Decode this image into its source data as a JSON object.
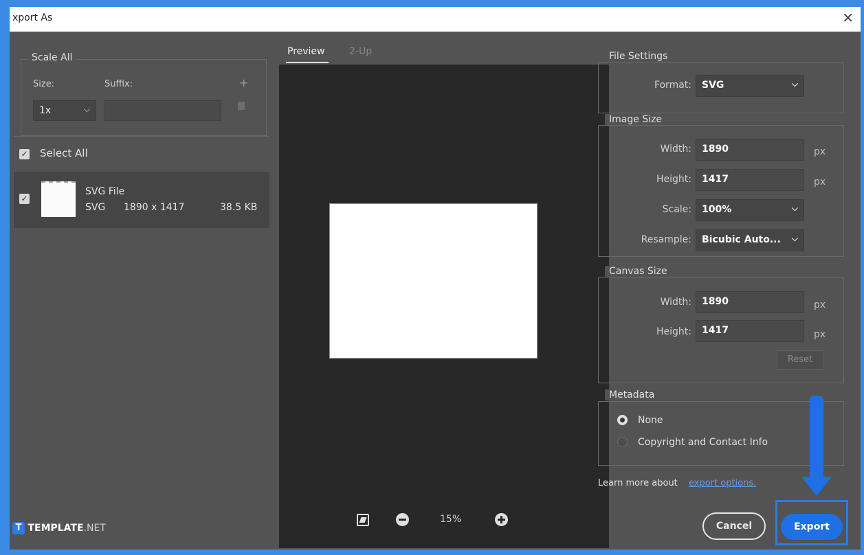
{
  "window": {
    "title": "xport As",
    "close_glyph": "✕"
  },
  "scale_all": {
    "title": "Scale All",
    "size_label": "Size:",
    "suffix_label": "Suffix:",
    "size_value": "1x",
    "suffix_value": "",
    "add_icon": "plus-icon",
    "delete_icon": "trash-icon"
  },
  "select_all": {
    "label": "Select All",
    "checked": true
  },
  "file_item": {
    "name": "SVG File",
    "format": "SVG",
    "dimensions": "1890 x 1417",
    "size": "38.5 KB",
    "checked": true
  },
  "watermark": {
    "brand_bold": "TEMPLATE",
    "brand_light": ".NET",
    "logo_letter": "T"
  },
  "preview": {
    "tabs": [
      {
        "label": "Preview",
        "active": true
      },
      {
        "label": "2-Up",
        "active": false
      }
    ],
    "zoom": "15%"
  },
  "file_settings": {
    "title": "File Settings",
    "format_label": "Format:",
    "format_value": "SVG"
  },
  "image_size": {
    "title": "Image Size",
    "width_label": "Width:",
    "width_value": "1890",
    "height_label": "Height:",
    "height_value": "1417",
    "unit": "px",
    "scale_label": "Scale:",
    "scale_value": "100%",
    "resample_label": "Resample:",
    "resample_value": "Bicubic Auto..."
  },
  "canvas_size": {
    "title": "Canvas Size",
    "width_label": "Width:",
    "width_value": "1890",
    "height_label": "Height:",
    "height_value": "1417",
    "unit": "px",
    "reset_label": "Reset"
  },
  "metadata": {
    "title": "Metadata",
    "options": [
      {
        "label": "None",
        "selected": true
      },
      {
        "label": "Copyright and Contact Info",
        "selected": false
      }
    ]
  },
  "learn_more": {
    "text": "Learn more about",
    "link": "export options."
  },
  "actions": {
    "cancel": "Cancel",
    "export": "Export"
  },
  "colors": {
    "accent": "#1f6fe5",
    "highlight": "#2c7be5"
  }
}
